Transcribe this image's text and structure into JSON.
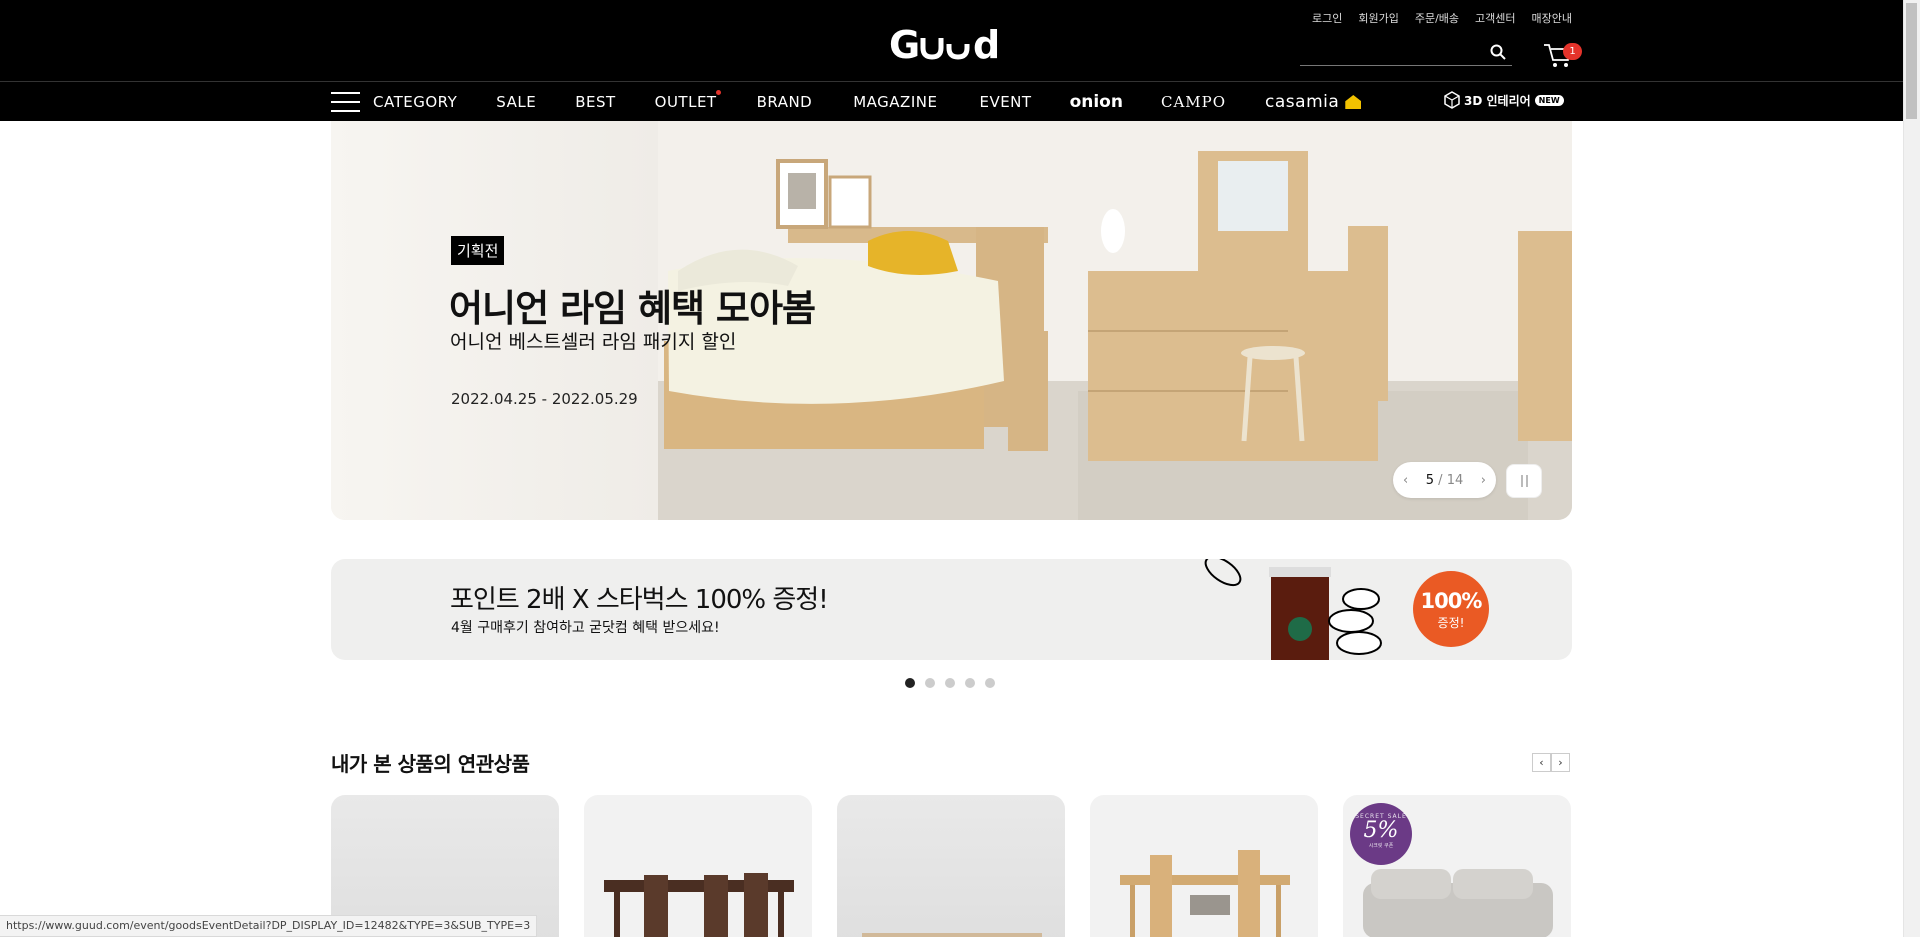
{
  "header": {
    "logo_text": "Guud",
    "util_links": [
      "로그인",
      "회원가입",
      "주문/배송",
      "고객센터",
      "매장안내"
    ],
    "search": {
      "placeholder": "",
      "value": ""
    },
    "cart_count": "1"
  },
  "gnb": {
    "items": [
      "CATEGORY",
      "SALE",
      "BEST",
      "OUTLET",
      "BRAND",
      "MAGAZINE",
      "EVENT",
      "onion",
      "CAMPO",
      "casamia"
    ],
    "interior_label": "3D 인테리어",
    "interior_badge": "NEW"
  },
  "hero": {
    "tag": "기획전",
    "title": "어니언 라임 혜택 모아봄",
    "subtitle": "어니언 베스트셀러 라임 패키지 할인",
    "date": "2022.04.25 - 2022.05.29",
    "pager_current": "5",
    "pager_separator": "/",
    "pager_total": "14"
  },
  "promo": {
    "title": "포인트 2배 X 스타벅스 100% 증정!",
    "subtitle": "4월 구매후기 참여하고 굳닷컴 혜택 받으세요!",
    "circle_big": "100%",
    "circle_small": "증정!",
    "slide_count": 5,
    "active_slide": 1
  },
  "related": {
    "title": "내가 본 상품의 연관상품",
    "prev": "‹",
    "next": "›",
    "badge": {
      "top": "SECRET SALE",
      "pct": "5%",
      "caption": "시크릿 쿠폰"
    }
  },
  "statusbar": {
    "url": "https://www.guud.com/event/goodsEventDetail?DP_DISPLAY_ID=12482&TYPE=3&SUB_TYPE=3"
  },
  "colors": {
    "header_bg": "#000000",
    "accent_red": "#e4332b",
    "promo_orange": "#ea5a24",
    "casamia_yellow": "#f2c200",
    "badge_purple": "#6b3a86"
  }
}
